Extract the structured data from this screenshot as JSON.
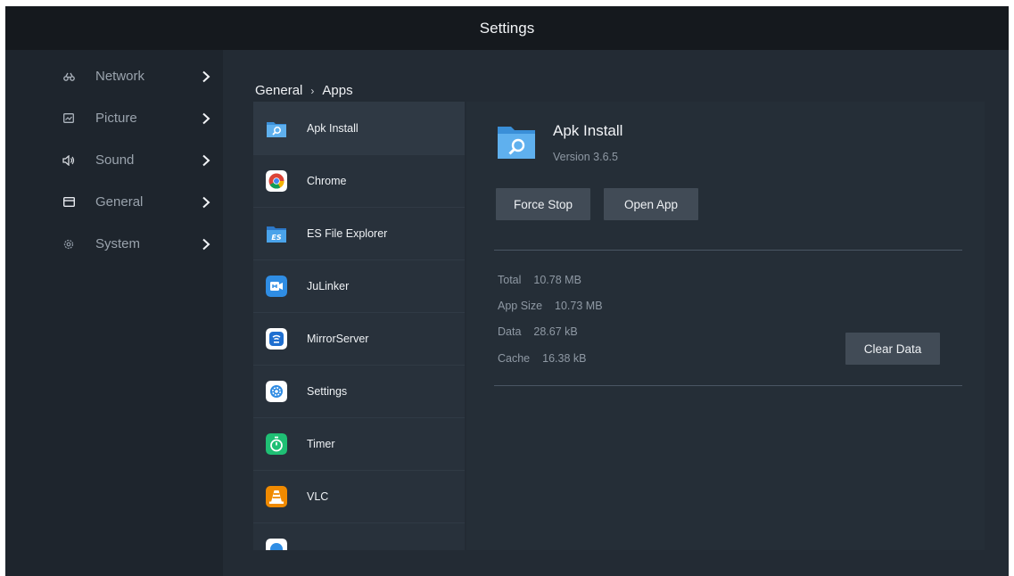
{
  "header": {
    "title": "Settings"
  },
  "sidebar": {
    "items": [
      {
        "label": "Network",
        "icon": "network-icon"
      },
      {
        "label": "Picture",
        "icon": "picture-icon"
      },
      {
        "label": "Sound",
        "icon": "sound-icon"
      },
      {
        "label": "General",
        "icon": "general-icon"
      },
      {
        "label": "System",
        "icon": "system-icon"
      }
    ]
  },
  "breadcrumb": {
    "parent": "General",
    "separator": "›",
    "current": "Apps"
  },
  "apps": [
    {
      "name": "Apk Install",
      "icon": "apk-install-icon"
    },
    {
      "name": "Chrome",
      "icon": "chrome-icon"
    },
    {
      "name": "ES File Explorer",
      "icon": "es-file-explorer-icon"
    },
    {
      "name": "JuLinker",
      "icon": "julinker-icon"
    },
    {
      "name": "MirrorServer",
      "icon": "mirrorserver-icon"
    },
    {
      "name": "Settings",
      "icon": "settings-icon"
    },
    {
      "name": "Timer",
      "icon": "timer-icon"
    },
    {
      "name": "VLC",
      "icon": "vlc-icon"
    }
  ],
  "detail": {
    "name": "Apk Install",
    "version": "Version 3.6.5",
    "force_stop_label": "Force Stop",
    "open_app_label": "Open App",
    "clear_data_label": "Clear Data",
    "total_label": "Total",
    "total_value": "10.78 MB",
    "app_size_label": "App Size",
    "app_size_value": "10.73 MB",
    "data_label": "Data",
    "data_value": "28.67 kB",
    "cache_label": "Cache",
    "cache_value": "16.38 kB"
  },
  "colors": {
    "background": "#232b34",
    "header": "#15191e",
    "sidebar": "#1e252d",
    "button": "#414b56"
  }
}
